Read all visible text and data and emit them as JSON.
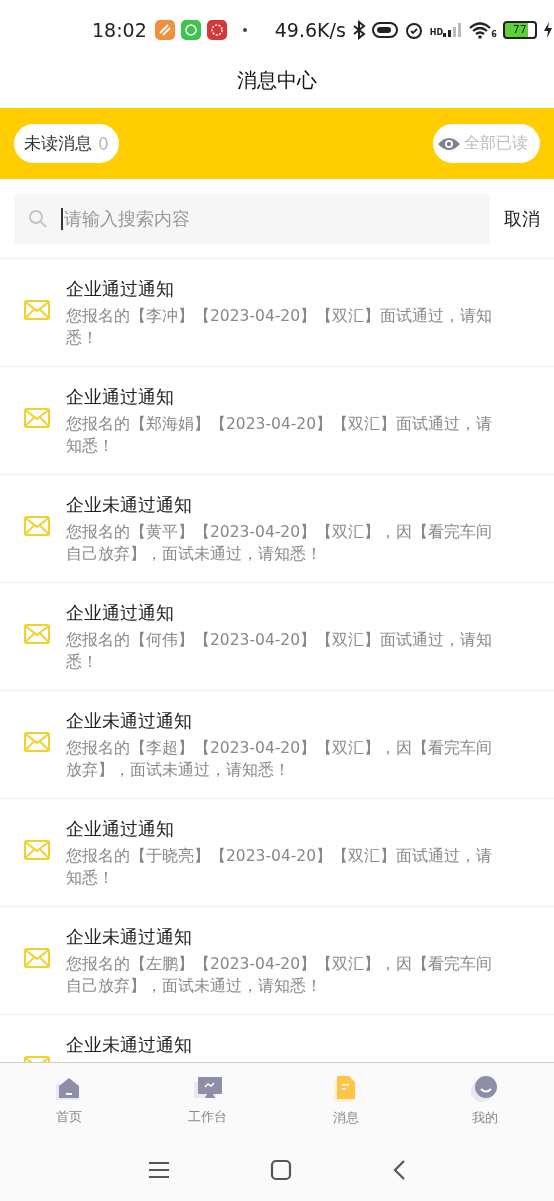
{
  "status_bar": {
    "time": "18:02",
    "speed": "49.6K/s",
    "signal_label": "HD",
    "wifi_label": "6",
    "battery": "77"
  },
  "title": "消息中心",
  "banner": {
    "unread_label": "未读消息",
    "unread_count": "0",
    "mark_all": "全部已读"
  },
  "search": {
    "placeholder": "请输入搜索内容",
    "cancel": "取消"
  },
  "messages": [
    {
      "title": "企业通过通知",
      "body": "您报名的【李冲】【2023-04-20】【双汇】面试通过，请知悉！"
    },
    {
      "title": "企业通过通知",
      "body": "您报名的【郑海娟】【2023-04-20】【双汇】面试通过，请知悉！"
    },
    {
      "title": "企业未通过通知",
      "body": "您报名的【黄平】【2023-04-20】【双汇】，因【看完车间自己放弃】，面试未通过，请知悉！"
    },
    {
      "title": "企业通过通知",
      "body": "您报名的【何伟】【2023-04-20】【双汇】面试通过，请知悉！"
    },
    {
      "title": "企业未通过通知",
      "body": "您报名的【李超】【2023-04-20】【双汇】，因【看完车间放弃】，面试未通过，请知悉！"
    },
    {
      "title": "企业通过通知",
      "body": "您报名的【于晓亮】【2023-04-20】【双汇】面试通过，请知悉！"
    },
    {
      "title": "企业未通过通知",
      "body": "您报名的【左鹏】【2023-04-20】【双汇】，因【看完车间自己放弃】，面试未通过，请知悉！"
    },
    {
      "title": "企业未通过通知"
    }
  ],
  "tabs": [
    {
      "label": "首页",
      "kind": "home",
      "selected": false
    },
    {
      "label": "工作台",
      "kind": "workbench",
      "selected": false
    },
    {
      "label": "消息",
      "kind": "message",
      "selected": true
    },
    {
      "label": "我的",
      "kind": "profile",
      "selected": false
    }
  ]
}
